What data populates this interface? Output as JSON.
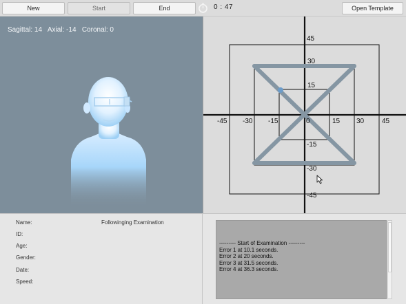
{
  "toolbar": {
    "new_label": "New",
    "start_label": "Start",
    "end_label": "End",
    "timer_icon": "stopwatch-icon",
    "timer_value": "0 : 47",
    "open_template_label": "Open Template"
  },
  "viewport": {
    "coords_text": "Sagittal: 14   Axial: -14   Coronal: 0",
    "model": "head-bust-3d"
  },
  "grid": {
    "x_ticks": [
      "-45",
      "-30",
      "-15",
      "15",
      "30",
      "45"
    ],
    "y_ticks": [
      "45",
      "30",
      "15",
      "-15",
      "-30",
      "-45"
    ],
    "origin_label": "0",
    "pattern": "hourglass",
    "cursor_icon": "mouse-pointer-icon"
  },
  "patient": {
    "title": "Followinging Examination",
    "name_label": "Name:",
    "id_label": "ID:",
    "age_label": "Age:",
    "gender_label": "Gender:",
    "date_label": "Date:",
    "speed_label": "Speed:"
  },
  "log": {
    "lines": [
      "--------- Start of Examination ---------",
      "Error 1 at 10.1 seconds.",
      "Error 2 at 20 seconds.",
      "Error 3 at 31.5 seconds.",
      "Error 4 at 36.3 seconds."
    ]
  },
  "colors": {
    "viewport_bg": "#7d8e9b",
    "grid_bg": "#dcdcdc",
    "path": "#8596a3",
    "marker": "#6c9cc9"
  }
}
